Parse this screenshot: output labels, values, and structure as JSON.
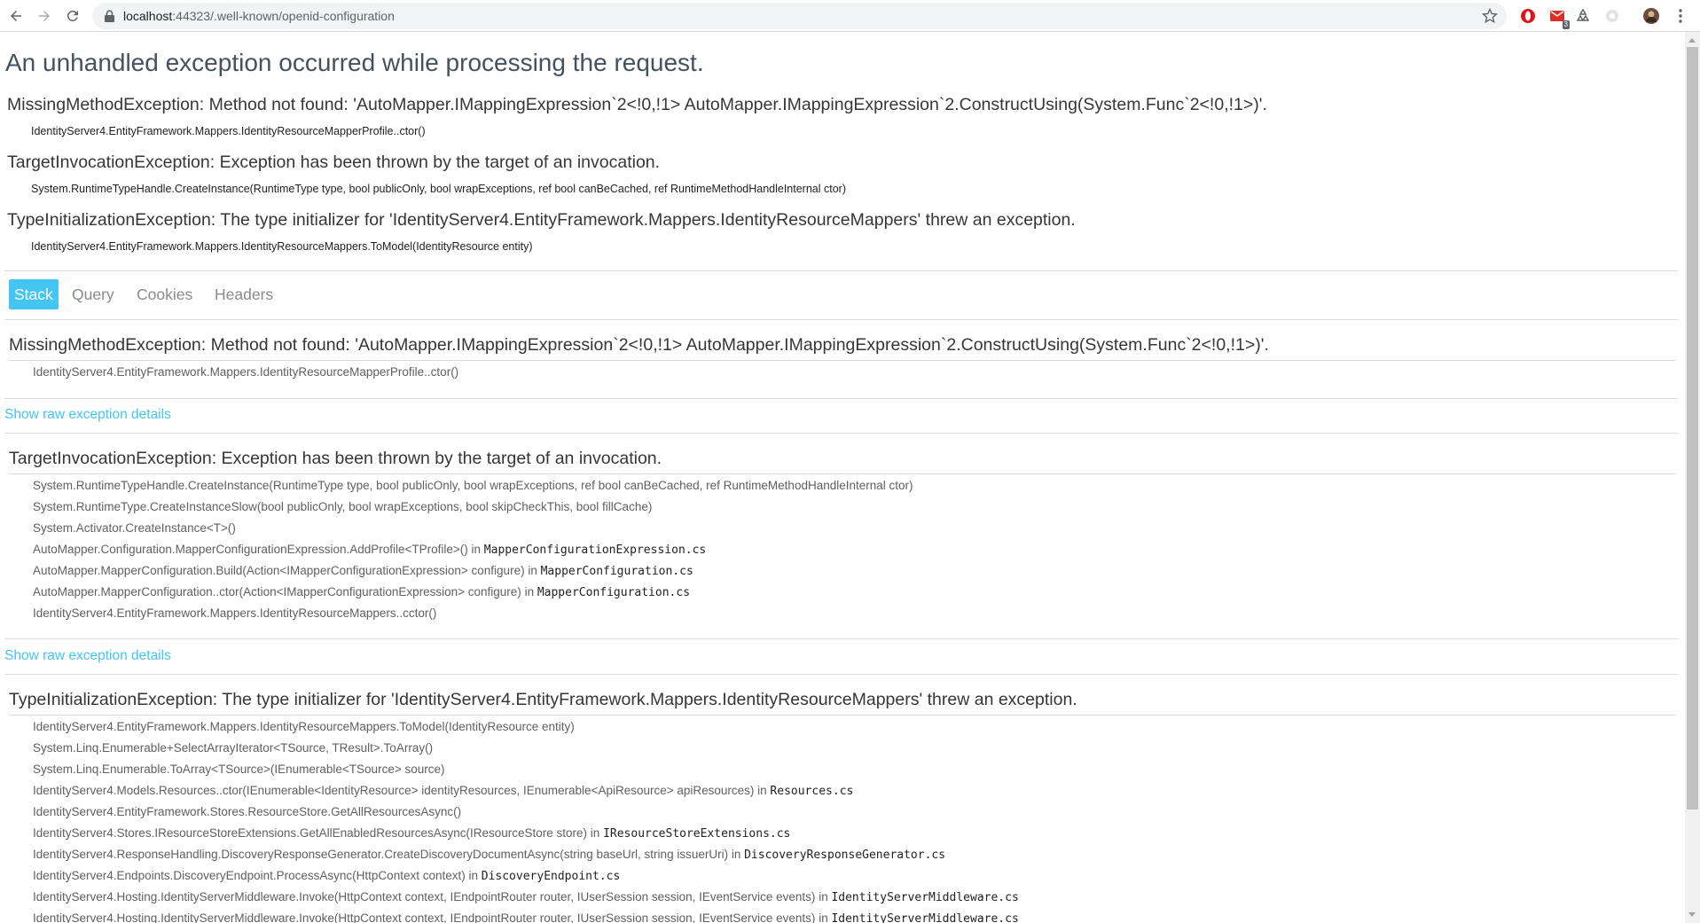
{
  "browser": {
    "url_host": "localhost",
    "url_rest": ":44323/.well-known/openid-configuration",
    "ext_badge": "3"
  },
  "page": {
    "title": "An unhandled exception occurred while processing the request.",
    "summary": [
      {
        "type": "MissingMethodException:",
        "message": "Method not found: 'AutoMapper.IMappingExpression`2<!0,!1> AutoMapper.IMappingExpression`2.ConstructUsing(System.Func`2<!0,!1>)'.",
        "frame": "IdentityServer4.EntityFramework.Mappers.IdentityResourceMapperProfile..ctor()"
      },
      {
        "type": "TargetInvocationException:",
        "message": "Exception has been thrown by the target of an invocation.",
        "frame": "System.RuntimeTypeHandle.CreateInstance(RuntimeType type, bool publicOnly, bool wrapExceptions, ref bool canBeCached, ref RuntimeMethodHandleInternal ctor)"
      },
      {
        "type": "TypeInitializationException:",
        "message": "The type initializer for 'IdentityServer4.EntityFramework.Mappers.IdentityResourceMappers' threw an exception.",
        "frame": "IdentityServer4.EntityFramework.Mappers.IdentityResourceMappers.ToModel(IdentityResource entity)"
      }
    ],
    "tabs": [
      "Stack",
      "Query",
      "Cookies",
      "Headers"
    ],
    "raw_link": "Show raw exception details",
    "stack": [
      {
        "title": "MissingMethodException: Method not found: 'AutoMapper.IMappingExpression`2<!0,!1> AutoMapper.IMappingExpression`2.ConstructUsing(System.Func`2<!0,!1>)'.",
        "frames": [
          {
            "text": "IdentityServer4.EntityFramework.Mappers.IdentityResourceMapperProfile..ctor()",
            "in": "",
            "file": ""
          }
        ]
      },
      {
        "title": "TargetInvocationException: Exception has been thrown by the target of an invocation.",
        "frames": [
          {
            "text": "System.RuntimeTypeHandle.CreateInstance(RuntimeType type, bool publicOnly, bool wrapExceptions, ref bool canBeCached, ref RuntimeMethodHandleInternal ctor)",
            "in": "",
            "file": ""
          },
          {
            "text": "System.RuntimeType.CreateInstanceSlow(bool publicOnly, bool wrapExceptions, bool skipCheckThis, bool fillCache)",
            "in": "",
            "file": ""
          },
          {
            "text": "System.Activator.CreateInstance<T>()",
            "in": "",
            "file": ""
          },
          {
            "text": "AutoMapper.Configuration.MapperConfigurationExpression.AddProfile<TProfile>()",
            "in": " in ",
            "file": "MapperConfigurationExpression.cs"
          },
          {
            "text": "AutoMapper.MapperConfiguration.Build(Action<IMapperConfigurationExpression> configure)",
            "in": " in ",
            "file": "MapperConfiguration.cs"
          },
          {
            "text": "AutoMapper.MapperConfiguration..ctor(Action<IMapperConfigurationExpression> configure)",
            "in": " in ",
            "file": "MapperConfiguration.cs"
          },
          {
            "text": "IdentityServer4.EntityFramework.Mappers.IdentityResourceMappers..cctor()",
            "in": "",
            "file": ""
          }
        ]
      },
      {
        "title": "TypeInitializationException: The type initializer for 'IdentityServer4.EntityFramework.Mappers.IdentityResourceMappers' threw an exception.",
        "frames": [
          {
            "text": "IdentityServer4.EntityFramework.Mappers.IdentityResourceMappers.ToModel(IdentityResource entity)",
            "in": "",
            "file": ""
          },
          {
            "text": "System.Linq.Enumerable+SelectArrayIterator<TSource, TResult>.ToArray()",
            "in": "",
            "file": ""
          },
          {
            "text": "System.Linq.Enumerable.ToArray<TSource>(IEnumerable<TSource> source)",
            "in": "",
            "file": ""
          },
          {
            "text": "IdentityServer4.Models.Resources..ctor(IEnumerable<IdentityResource> identityResources, IEnumerable<ApiResource> apiResources)",
            "in": " in ",
            "file": "Resources.cs"
          },
          {
            "text": "IdentityServer4.EntityFramework.Stores.ResourceStore.GetAllResourcesAsync()",
            "in": "",
            "file": ""
          },
          {
            "text": "IdentityServer4.Stores.IResourceStoreExtensions.GetAllEnabledResourcesAsync(IResourceStore store)",
            "in": " in ",
            "file": "IResourceStoreExtensions.cs"
          },
          {
            "text": "IdentityServer4.ResponseHandling.DiscoveryResponseGenerator.CreateDiscoveryDocumentAsync(string baseUrl, string issuerUri)",
            "in": " in ",
            "file": "DiscoveryResponseGenerator.cs"
          },
          {
            "text": "IdentityServer4.Endpoints.DiscoveryEndpoint.ProcessAsync(HttpContext context)",
            "in": " in ",
            "file": "DiscoveryEndpoint.cs"
          },
          {
            "text": "IdentityServer4.Hosting.IdentityServerMiddleware.Invoke(HttpContext context, IEndpointRouter router, IUserSession session, IEventService events)",
            "in": " in ",
            "file": "IdentityServerMiddleware.cs"
          },
          {
            "text": "IdentityServer4.Hosting.IdentityServerMiddleware.Invoke(HttpContext context, IEndpointRouter router, IUserSession session, IEventService events)",
            "in": " in ",
            "file": "IdentityServerMiddleware.cs"
          }
        ]
      }
    ]
  },
  "colors": {
    "accent": "#44c5f2",
    "title": "#44525e",
    "text": "#363636"
  }
}
